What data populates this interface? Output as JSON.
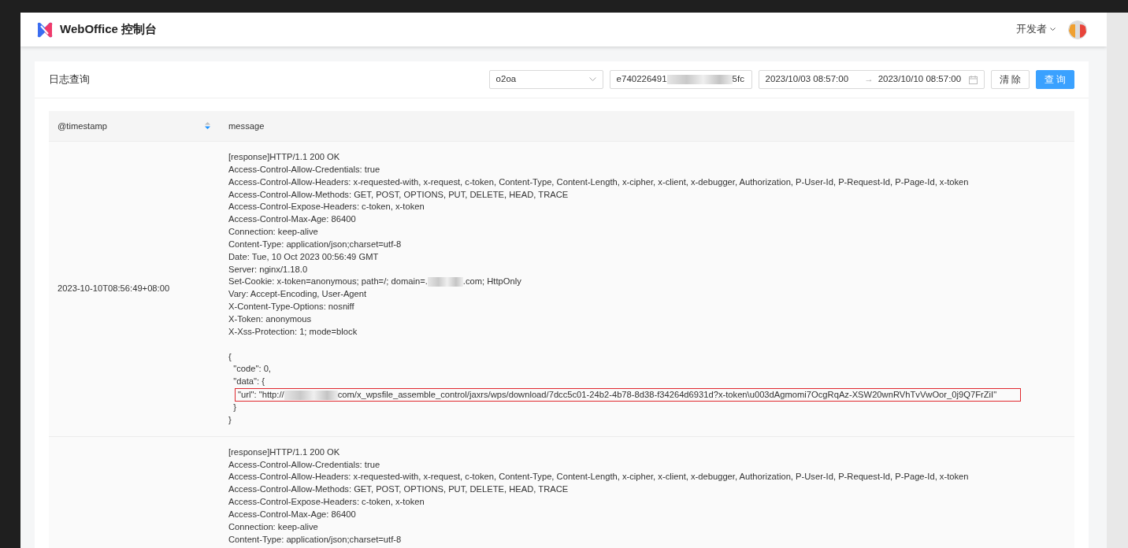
{
  "header": {
    "title": "WebOffice 控制台",
    "user_menu": "开发者"
  },
  "panel": {
    "title": "日志查询",
    "filters": {
      "app_select": "o2oa",
      "id_field": {
        "value_start": "e740226491",
        "value_end": "5fc"
      },
      "date_range": {
        "start": "2023/10/03 08:57:00",
        "separator": "→",
        "end": "2023/10/10 08:57:00"
      }
    },
    "buttons": [
      {
        "label": "清 除",
        "kind": "default"
      },
      {
        "label": "查 询",
        "kind": "primary"
      }
    ]
  },
  "table": {
    "columns": [
      {
        "label": "@timestamp",
        "sortable": true
      },
      {
        "label": "message",
        "sortable": false
      }
    ],
    "rows": [
      {
        "timestamp": "2023-10-10T08:56:49+08:00",
        "headers": [
          {
            "text": "[response]HTTP/1.1 200 OK"
          },
          {
            "text": "Access-Control-Allow-Credentials: true"
          },
          {
            "text": "Access-Control-Allow-Headers: x-requested-with, x-request, c-token, Content-Type, Content-Length, x-cipher, x-client, x-debugger, Authorization, P-User-Id, P-Request-Id, P-Page-Id, x-token"
          },
          {
            "text": "Access-Control-Allow-Methods: GET, POST, OPTIONS, PUT, DELETE, HEAD, TRACE"
          },
          {
            "text": "Access-Control-Expose-Headers: c-token, x-token"
          },
          {
            "text": "Access-Control-Max-Age: 86400"
          },
          {
            "text": "Connection: keep-alive"
          },
          {
            "text": "Content-Type: application/json;charset=utf-8"
          },
          {
            "text": "Date: Tue, 10 Oct 2023 00:56:49 GMT"
          },
          {
            "text": "Server: nginx/1.18.0"
          },
          {
            "text": "Set-Cookie: x-token=anonymous; path=/; domain=.",
            "redacted_after": ".com; HttpOnly"
          },
          {
            "text": "Vary: Accept-Encoding, User-Agent"
          },
          {
            "text": "X-Content-Type-Options: nosniff"
          },
          {
            "text": "X-Token: anonymous"
          },
          {
            "text": "X-Xss-Protection: 1; mode=block"
          }
        ],
        "body": [
          {
            "text": "{",
            "highlighted": false
          },
          {
            "text": "  \"code\": 0,",
            "highlighted": false
          },
          {
            "text": "  \"data\": {",
            "highlighted": false
          },
          {
            "text": "   \"url\": \"http://",
            "redacted_after": "com/x_wpsfile_assemble_control/jaxrs/wps/download/7dcc5c01-24b2-4b78-8d38-f34264d6931d?x-token\\u003dAgmomi7OcgRqAz-XSW20wnRVhTvVwOor_0j9Q7FrZiI\"",
            "highlighted": true
          },
          {
            "text": "  }",
            "highlighted": false
          },
          {
            "text": "}",
            "highlighted": false
          }
        ]
      },
      {
        "timestamp": "",
        "headers": [
          {
            "text": "[response]HTTP/1.1 200 OK"
          },
          {
            "text": "Access-Control-Allow-Credentials: true"
          },
          {
            "text": "Access-Control-Allow-Headers: x-requested-with, x-request, c-token, Content-Type, Content-Length, x-cipher, x-client, x-debugger, Authorization, P-User-Id, P-Request-Id, P-Page-Id, x-token"
          },
          {
            "text": "Access-Control-Allow-Methods: GET, POST, OPTIONS, PUT, DELETE, HEAD, TRACE"
          },
          {
            "text": "Access-Control-Expose-Headers: c-token, x-token"
          },
          {
            "text": "Access-Control-Max-Age: 86400"
          },
          {
            "text": "Connection: keep-alive"
          },
          {
            "text": "Content-Type: application/json;charset=utf-8"
          }
        ]
      }
    ]
  }
}
